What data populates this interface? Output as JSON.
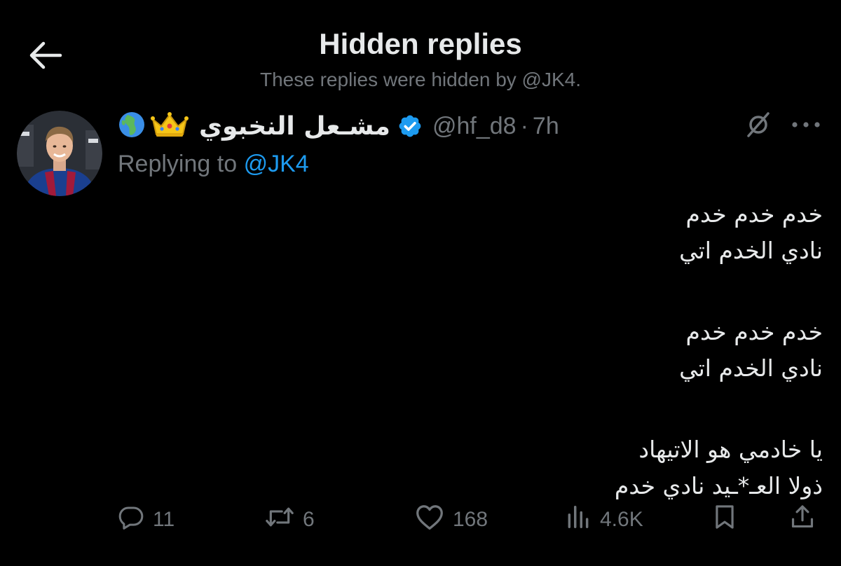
{
  "header": {
    "title": "Hidden replies",
    "subtitle": "These replies were hidden by @JK4."
  },
  "tweet": {
    "author_emojis": [
      "globe-africa-emoji",
      "crown-emoji"
    ],
    "display_name": "مشـعل النخبوي",
    "verified_color": "#1d9bf0",
    "handle": "@hf_d8",
    "separator": "·",
    "time": "7h",
    "replying_prefix": "Replying to",
    "replying_to": "@JK4",
    "body_paragraphs": [
      [
        "خدم خدم خدم",
        "نادي الخدم اتي"
      ],
      [
        "خدم خدم خدم",
        "نادي الخدم اتي"
      ],
      [
        "يا خادمي هو الاتيهاد",
        "ذولا العـ*ـيد نادي خدم"
      ]
    ],
    "stats": {
      "replies": "11",
      "reposts": "6",
      "likes": "168",
      "views": "4.6K"
    }
  },
  "colors": {
    "background": "#000000",
    "text_primary": "#e7e9ea",
    "text_secondary": "#71767b",
    "accent": "#1d9bf0"
  },
  "icons": {
    "back": "arrow-left-icon",
    "grok": "grok-icon",
    "more": "more-horizontal-icon",
    "reply": "reply-icon",
    "repost": "repost-icon",
    "like": "heart-icon",
    "views": "views-icon",
    "bookmark": "bookmark-icon",
    "share": "share-icon"
  }
}
